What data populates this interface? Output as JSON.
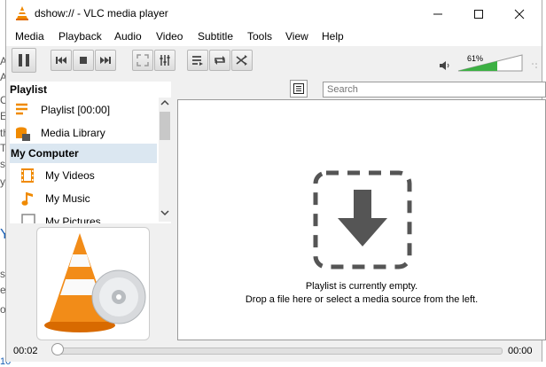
{
  "window": {
    "title": "dshow:// - VLC media player"
  },
  "menu": [
    "Media",
    "Playback",
    "Audio",
    "Video",
    "Subtitle",
    "Tools",
    "View",
    "Help"
  ],
  "volume": {
    "percent_label": "61%",
    "level": 0.61
  },
  "search": {
    "placeholder": "Search"
  },
  "sidebar": {
    "playlist_header": "Playlist",
    "playlist_items": [
      {
        "label": "Playlist [00:00]",
        "icon": "playlist-icon"
      },
      {
        "label": "Media Library",
        "icon": "media-library-icon"
      }
    ],
    "computer_header": "My Computer",
    "computer_items": [
      {
        "label": "My Videos",
        "icon": "film-icon"
      },
      {
        "label": "My Music",
        "icon": "music-note-icon"
      },
      {
        "label": "My Pictures",
        "icon": "pictures-icon"
      }
    ]
  },
  "main": {
    "empty_line1": "Playlist is currently empty.",
    "empty_line2": "Drop a file here or select a media source from the left."
  },
  "status": {
    "elapsed": "00:02",
    "total": "00:00",
    "progress": 0
  },
  "behind": {
    "lines": [
      "A",
      "A",
      "C",
      "E",
      "th",
      "T",
      "s",
      "y",
      "Y",
      "s",
      "et",
      "or",
      "10"
    ]
  }
}
